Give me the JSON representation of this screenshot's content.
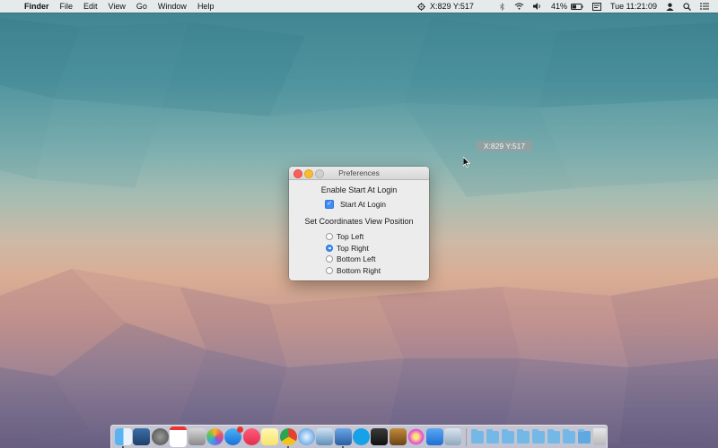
{
  "menubar": {
    "apple_glyph": "",
    "app_name": "Finder",
    "menus": [
      "File",
      "Edit",
      "View",
      "Go",
      "Window",
      "Help"
    ],
    "coords_text": "X:829 Y:517",
    "battery_text": "41%",
    "clock_text": "Tue 11:21:09",
    "icons": [
      "crosshair-icon",
      "bluetooth-icon",
      "wifi-icon",
      "volume-icon",
      "battery-icon",
      "input-menu-icon",
      "user-icon",
      "spotlight-icon",
      "notification-center-icon"
    ]
  },
  "coordinate_label": {
    "text": "X:829 Y:517"
  },
  "preferences": {
    "title": "Preferences",
    "login_section_title": "Enable Start At Login",
    "start_at_login_label": "Start At Login",
    "start_at_login_checked": true,
    "position_section_title": "Set Coordinates View Position",
    "position_options": [
      "Top Left",
      "Top Right",
      "Bottom Left",
      "Bottom Right"
    ],
    "selected_position": "Top Right"
  },
  "dock": {
    "apps": [
      "finder",
      "mission-control",
      "system-preferences",
      "calendar",
      "mail-stamps",
      "photos",
      "app-store",
      "itunes",
      "notes",
      "chrome",
      "safari",
      "preview",
      "xcode",
      "skype",
      "tool",
      "automator",
      "flower",
      "dropbox",
      "box"
    ],
    "folders": [
      "applications",
      "documents",
      "downloads",
      "folder",
      "folder",
      "folder",
      "folder",
      "downloads-stack"
    ],
    "trash": "trash"
  },
  "colors": {
    "accent": "#3d8ff5",
    "close": "#fc5f57",
    "minimize": "#fdbc2e"
  }
}
